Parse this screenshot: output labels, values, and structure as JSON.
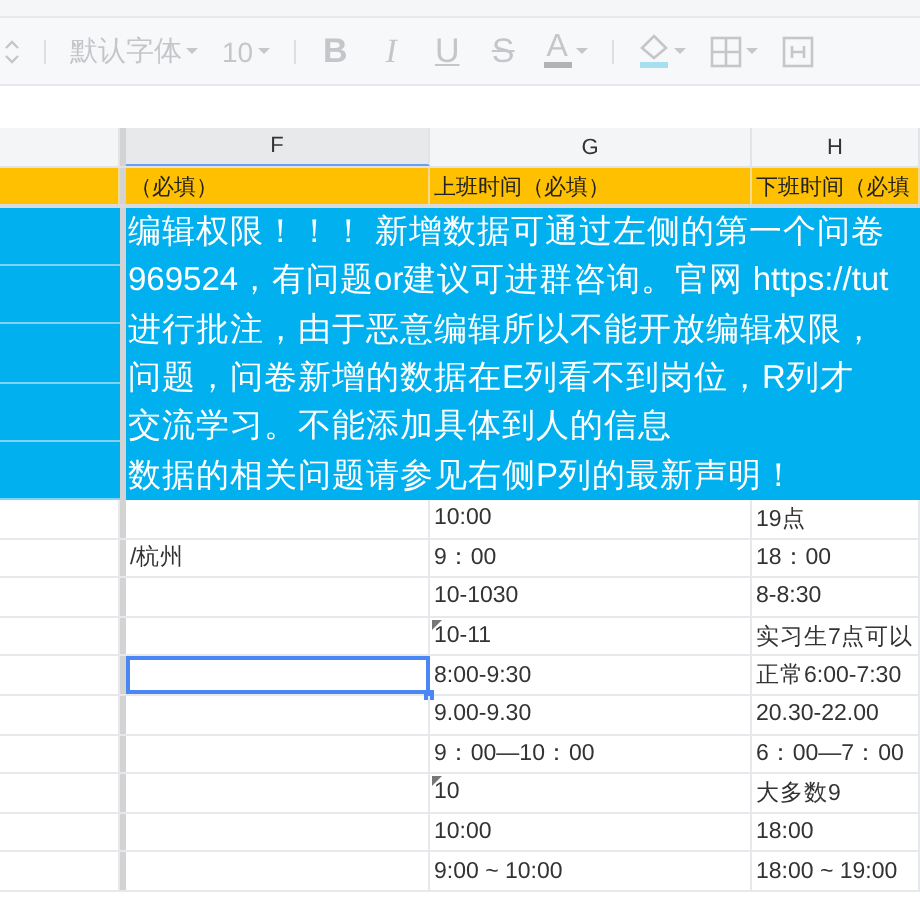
{
  "toolbar": [
    {
      "kind": "stepper",
      "disabled": true
    },
    {
      "kind": "dropdown",
      "label": "默认字体",
      "disabled": true
    },
    {
      "kind": "dropdown",
      "label": "10",
      "disabled": true
    },
    {
      "kind": "bold",
      "label": "B",
      "disabled": true
    },
    {
      "kind": "italic",
      "label": "I",
      "disabled": true
    },
    {
      "kind": "underline",
      "label": "U",
      "disabled": true
    },
    {
      "kind": "strike",
      "label": "S",
      "disabled": true
    },
    {
      "kind": "color",
      "label": "A",
      "color": "#b3b3b3",
      "disabled": true
    },
    {
      "kind": "fill",
      "color": "#a8dff0",
      "disabled": true
    },
    {
      "kind": "borders",
      "disabled": true
    },
    {
      "kind": "merge",
      "disabled": true
    }
  ],
  "columns": [
    {
      "label": "F",
      "selected": true
    },
    {
      "label": "G",
      "selected": false
    },
    {
      "label": "H",
      "selected": false
    }
  ],
  "header_row": [
    "（必填）",
    "上班时间（必填）",
    "下班时间（必填"
  ],
  "notice_lines": [
    "编辑权限！！！ 新增数据可通过左侧的第一个问卷",
    "969524，有问题or建议可进群咨询。官网 https://tut",
    "进行批注，由于恶意编辑所以不能开放编辑权限，",
    "问题，问卷新增的数据在E列看不到岗位，R列才",
    "交流学习。不能添加具体到人的信息",
    "数据的相关问题请参见右侧P列的最新声明！"
  ],
  "rows": [
    {
      "selected": false,
      "cells": [
        {
          "text": ""
        },
        {
          "text": "10:00"
        },
        {
          "text": "19点"
        }
      ]
    },
    {
      "selected": false,
      "cells": [
        {
          "text": "/杭州"
        },
        {
          "text": "9：00"
        },
        {
          "text": "18：00"
        }
      ]
    },
    {
      "selected": false,
      "cells": [
        {
          "text": ""
        },
        {
          "text": "10-1030"
        },
        {
          "text": "8-8:30"
        }
      ]
    },
    {
      "selected": false,
      "cells": [
        {
          "text": ""
        },
        {
          "text": "10-11",
          "comment": true
        },
        {
          "text": "实习生7点可以"
        }
      ]
    },
    {
      "selected": true,
      "cells": [
        {
          "text": ""
        },
        {
          "text": "8:00-9:30"
        },
        {
          "text": "正常6:00-7:30"
        }
      ]
    },
    {
      "selected": false,
      "cells": [
        {
          "text": ""
        },
        {
          "text": "9.00-9.30"
        },
        {
          "text": "20.30-22.00"
        }
      ]
    },
    {
      "selected": false,
      "cells": [
        {
          "text": ""
        },
        {
          "text": "9：00—10：00"
        },
        {
          "text": "6：00—7：00"
        }
      ]
    },
    {
      "selected": false,
      "cells": [
        {
          "text": ""
        },
        {
          "text": "10",
          "comment": true
        },
        {
          "text": "大多数9"
        }
      ]
    },
    {
      "selected": false,
      "cells": [
        {
          "text": ""
        },
        {
          "text": "10:00"
        },
        {
          "text": "18:00"
        }
      ]
    },
    {
      "selected": false,
      "cells": [
        {
          "text": ""
        },
        {
          "text": "9:00 ~ 10:00"
        },
        {
          "text": "18:00 ~ 19:00"
        }
      ]
    }
  ]
}
